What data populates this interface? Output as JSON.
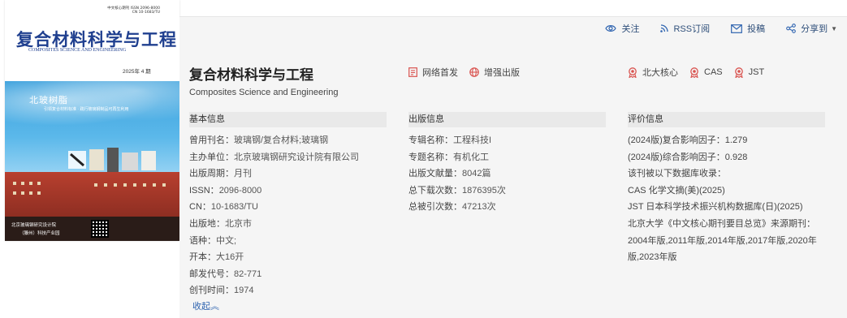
{
  "actions": {
    "follow": "关注",
    "rss": "RSS订阅",
    "submit": "投稿",
    "share": "分享到"
  },
  "cover": {
    "issn_line1": "中文核心期刊    ISSN 2096-8000",
    "issn_line2": "CN 10-1683/TU",
    "title": "复合材料科学与工程",
    "title_en": "COMPOSITES SCIENCE AND ENGINEERING",
    "issue": "2025年 4 期",
    "tagline": "北玻树脂",
    "tagline2": "引领复合材料标准 · 践行玻璃钢制品可再生利用",
    "footer1": "北京玻璃钢研究设计院",
    "footer2": "（滕州）科技产业园"
  },
  "journal": {
    "title": "复合材料科学与工程",
    "subtitle": "Composites Science and Engineering"
  },
  "pub_tags": [
    "网络首发",
    "增强出版"
  ],
  "index_tags": [
    "北大核心",
    "CAS",
    "JST"
  ],
  "basic": {
    "heading": "基本信息",
    "rows": [
      {
        "label": "曾用刊名：",
        "value": "玻璃钢/复合材料;玻璃钢"
      },
      {
        "label": "主办单位：",
        "value": "北京玻璃钢研究设计院有限公司"
      },
      {
        "label": "出版周期：",
        "value": "月刊"
      },
      {
        "label": "ISSN：",
        "value": "2096-8000"
      },
      {
        "label": "CN：",
        "value": "10-1683/TU"
      },
      {
        "label": "出版地：",
        "value": "北京市"
      },
      {
        "label": "语种：",
        "value": "中文;"
      },
      {
        "label": "开本：",
        "value": "大16开"
      },
      {
        "label": "邮发代号：",
        "value": "82-771"
      },
      {
        "label": "创刊时间：",
        "value": "1974"
      }
    ],
    "collapse": "收起"
  },
  "publish": {
    "heading": "出版信息",
    "rows": [
      {
        "label": "专辑名称：",
        "value": "工程科技I"
      },
      {
        "label": "专题名称：",
        "value": "有机化工"
      },
      {
        "label": "出版文献量：",
        "value": "8042篇"
      },
      {
        "label": "总下载次数：",
        "value": "1876395次"
      },
      {
        "label": "总被引次数：",
        "value": "47213次"
      }
    ]
  },
  "eval": {
    "heading": "评价信息",
    "rows": [
      "(2024版)复合影响因子：1.279",
      "(2024版)综合影响因子：0.928",
      "该刊被以下数据库收录：",
      "CAS 化学文摘(美)(2025)",
      "JST 日本科学技术振兴机构数据库(日)(2025)",
      "北京大学《中文核心期刊要目总览》来源期刊：",
      "2004年版,2011年版,2014年版,2017年版,2020年版,2023年版"
    ]
  },
  "colors": {
    "accent_blue": "#2f64b0",
    "icon_red": "#d9534f",
    "panel_bg": "#f5f5f5"
  }
}
